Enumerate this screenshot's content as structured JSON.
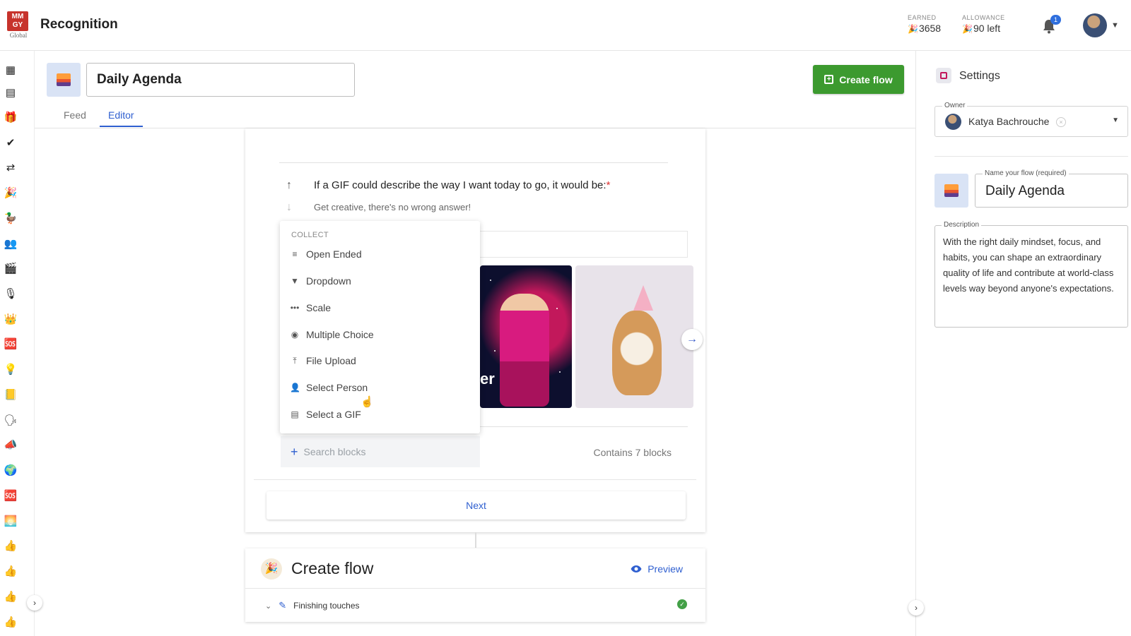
{
  "app": {
    "logo_text": "MM GY",
    "logo_sub": "Global",
    "title": "Recognition"
  },
  "stats": {
    "earned_label": "EARNED",
    "earned_value": "3658",
    "allowance_label": "ALLOWANCE",
    "allowance_value": "90 left"
  },
  "notifications": {
    "count": "1"
  },
  "rail": {
    "icons": [
      "dashboard-icon",
      "list-icon",
      "gift-icon",
      "check-circle-icon",
      "workflow-icon",
      "party-icon",
      "duck-icon",
      "people-icon",
      "clapper-icon",
      "microphone-icon",
      "crown-icon",
      "sos-icon",
      "bulb-icon",
      "note-icon",
      "chat-icon",
      "megaphone-icon",
      "globe-icon",
      "sos-icon-2",
      "sunset-icon",
      "thumbs-up-icon",
      "thumbs-up-icon-2",
      "thumbs-up-icon-3",
      "thumbs-up-icon-4"
    ],
    "glyphs": [
      "▦",
      "▤",
      "🎁",
      "✔",
      "⇄",
      "🎉",
      "🦆",
      "👥",
      "🎬",
      "🎙",
      "👑",
      "🆘",
      "💡",
      "📒",
      "🗣",
      "📣",
      "🌍",
      "🆘",
      "🌅",
      "👍",
      "👍",
      "👍",
      "👍"
    ]
  },
  "editor": {
    "flow_title": "Daily Agenda",
    "create_flow_label": "Create flow",
    "tabs": [
      {
        "label": "Feed"
      },
      {
        "label": "Editor"
      }
    ]
  },
  "question": {
    "title": "If a GIF could describe the way I want today to go, it would be:",
    "required_mark": "*",
    "subtitle": "Get creative, there's no wrong answer!",
    "gif_caption": "er"
  },
  "collect_menu": {
    "header": "COLLECT",
    "items": [
      {
        "label": "Open Ended",
        "icon": "lines-icon",
        "glyph": "≡"
      },
      {
        "label": "Dropdown",
        "icon": "triangle-down-icon",
        "glyph": "▼"
      },
      {
        "label": "Scale",
        "icon": "dots-icon",
        "glyph": "•••"
      },
      {
        "label": "Multiple Choice",
        "icon": "radio-icon",
        "glyph": "◉"
      },
      {
        "label": "File Upload",
        "icon": "upload-icon",
        "glyph": "⤒"
      },
      {
        "label": "Select Person",
        "icon": "person-icon",
        "glyph": "👤"
      },
      {
        "label": "Select a GIF",
        "icon": "gif-icon",
        "glyph": "▤"
      }
    ]
  },
  "blocks": {
    "search_placeholder": "Search blocks",
    "contains_text": "Contains 7 blocks",
    "next_label": "Next"
  },
  "create_flow_panel": {
    "title": "Create flow",
    "preview_label": "Preview",
    "section_label": "Finishing touches"
  },
  "settings": {
    "title": "Settings",
    "owner_legend": "Owner",
    "owner_name": "Katya Bachrouche",
    "name_legend": "Name your flow (required)",
    "name_value": "Daily Agenda",
    "description_legend": "Description",
    "description_value": "With the right daily mindset, focus, and habits, you can shape an extraordinary quality of life and contribute at world-class levels way beyond anyone's expectations."
  },
  "colors": {
    "accent": "#2f5fd0",
    "primary_button": "#3c9a2f",
    "logo": "#c7332c"
  }
}
